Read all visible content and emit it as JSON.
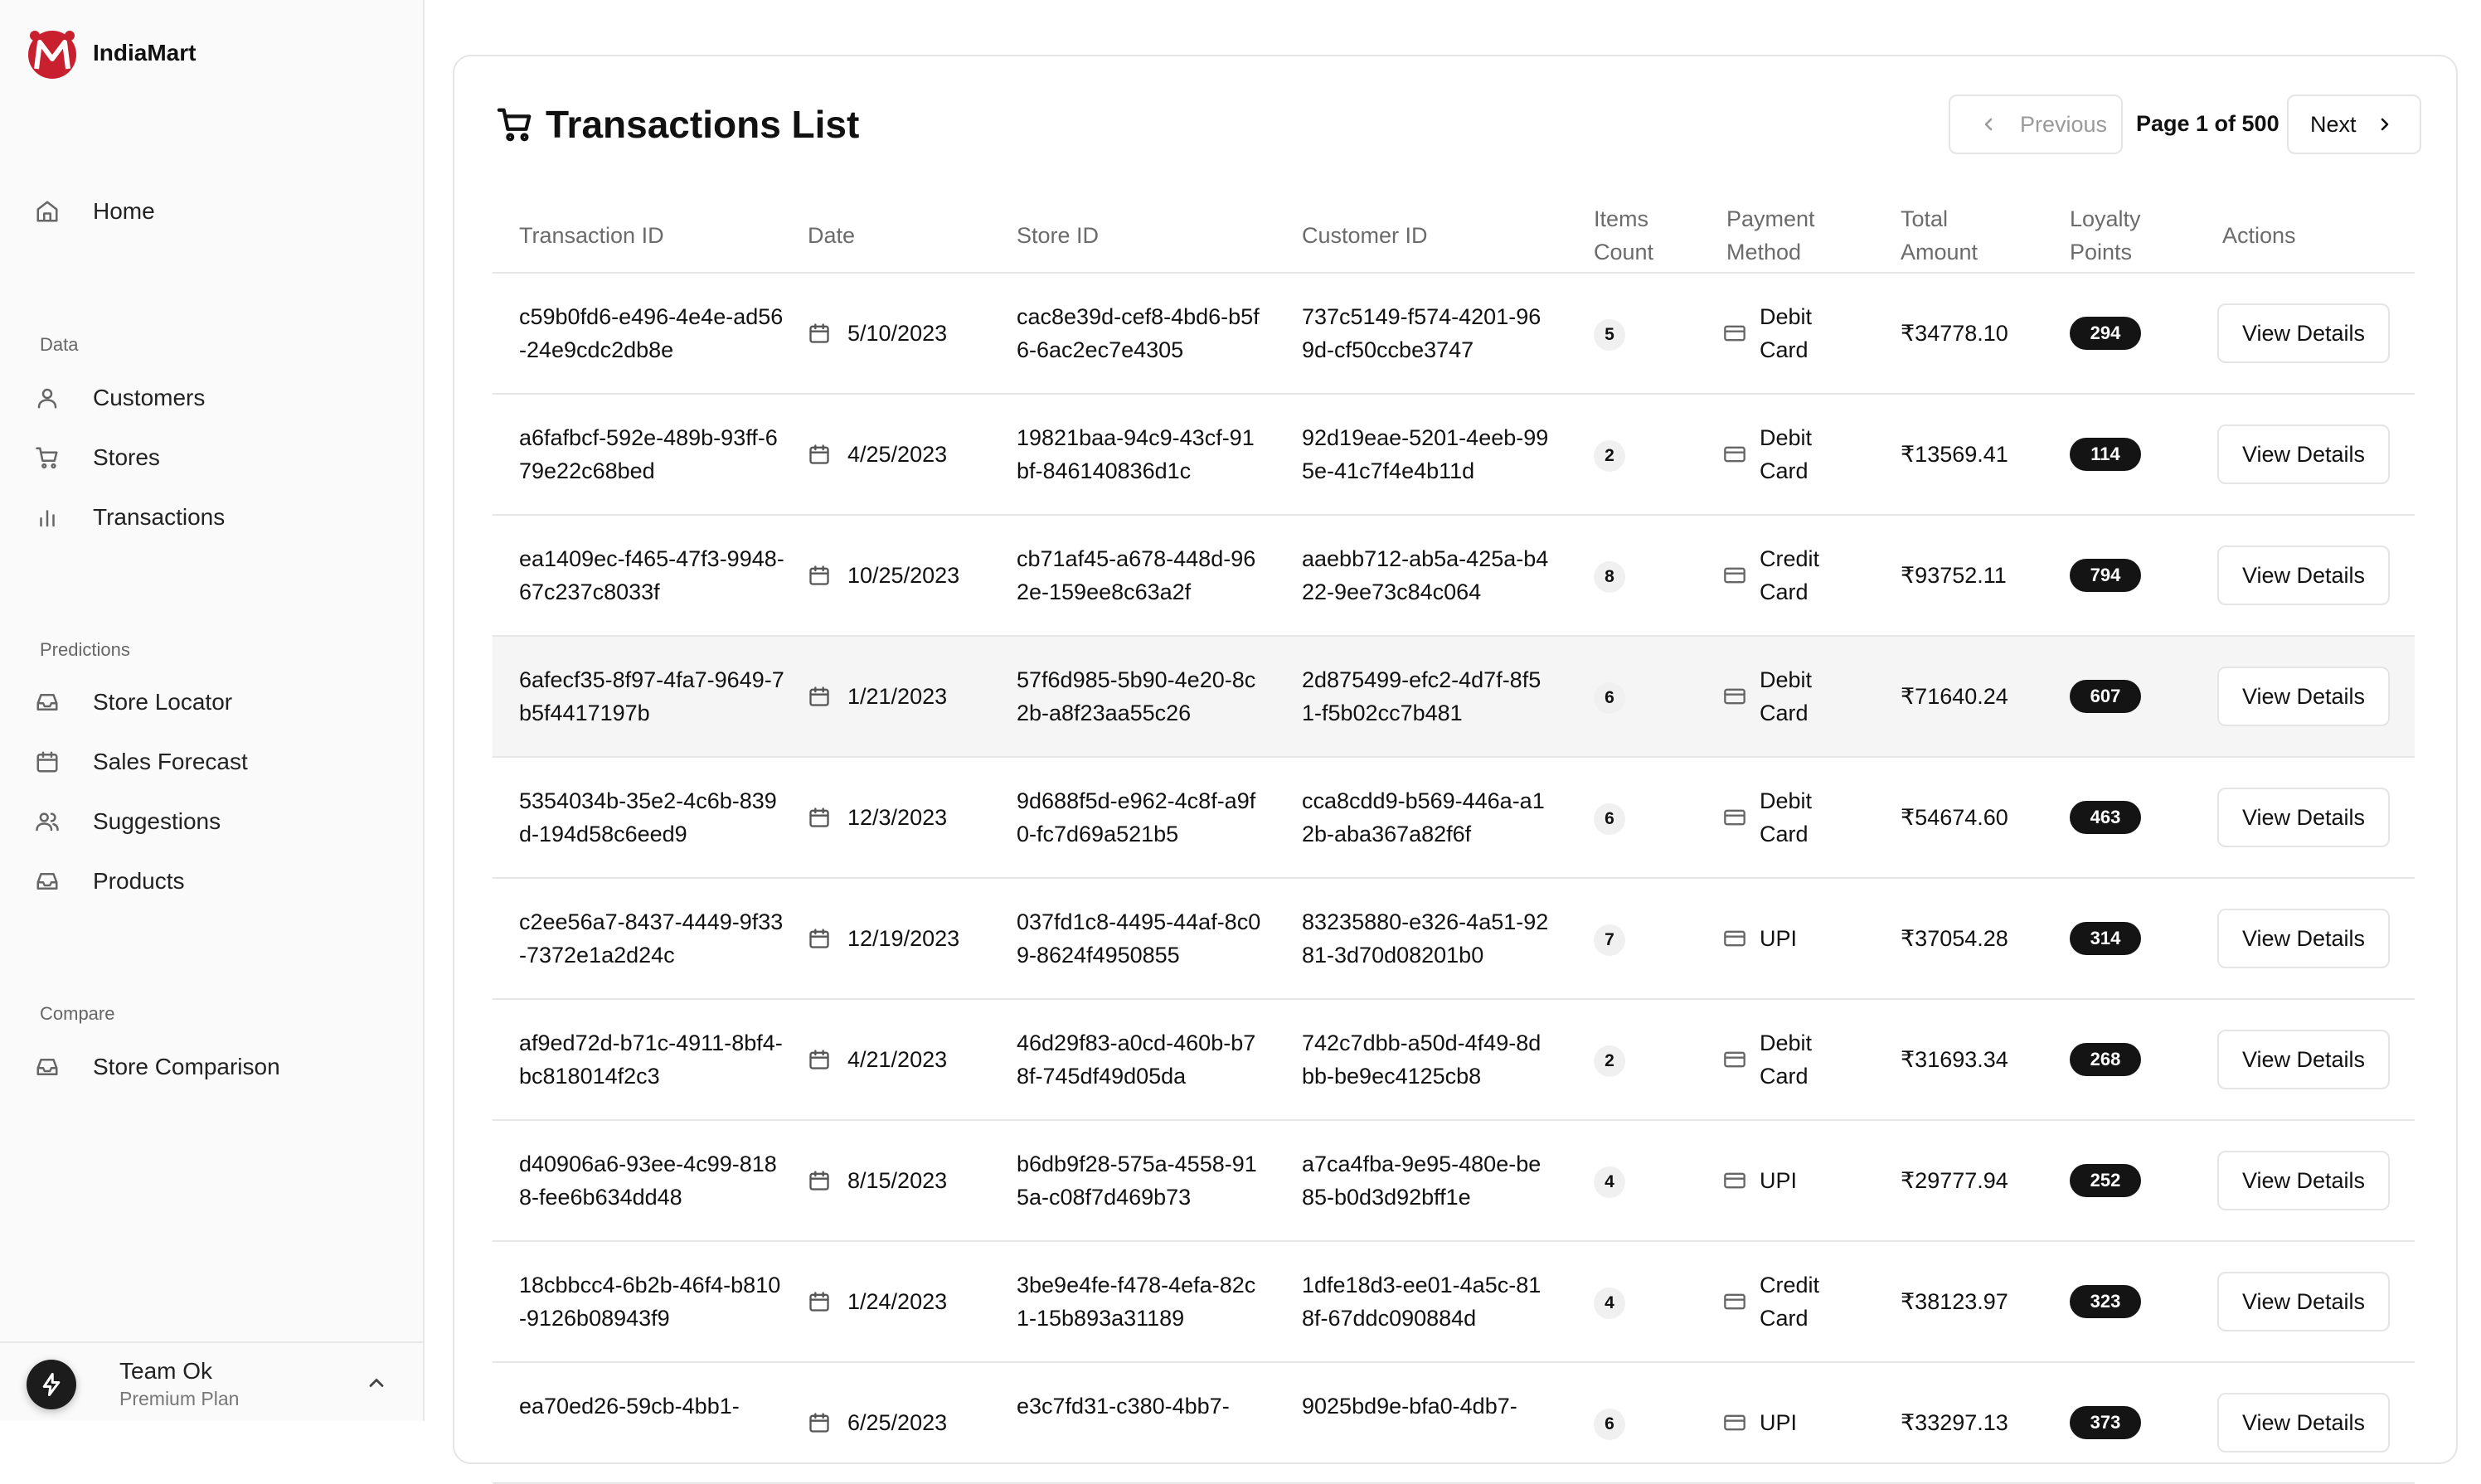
{
  "brand": {
    "name": "IndiaMart"
  },
  "sidebar": {
    "home": {
      "label": "Home",
      "icon": "home-icon"
    },
    "groups": {
      "data": "Data",
      "predictions": "Predictions",
      "compare": "Compare"
    },
    "data_items": [
      {
        "label": "Customers",
        "icon": "user-icon"
      },
      {
        "label": "Stores",
        "icon": "cart-icon"
      },
      {
        "label": "Transactions",
        "icon": "bar-chart-icon"
      }
    ],
    "prediction_items": [
      {
        "label": "Store Locator",
        "icon": "inbox-icon"
      },
      {
        "label": "Sales Forecast",
        "icon": "calendar-icon"
      },
      {
        "label": "Suggestions",
        "icon": "users-icon"
      },
      {
        "label": "Products",
        "icon": "inbox-icon"
      }
    ],
    "compare_items": [
      {
        "label": "Store Comparison",
        "icon": "inbox-icon"
      }
    ],
    "team": {
      "name": "Team Ok",
      "plan": "Premium Plan"
    }
  },
  "header": {
    "title": "Transactions List",
    "prev_label": "Previous",
    "page_indicator": "Page 1 of 500",
    "next_label": "Next"
  },
  "table": {
    "columns": [
      "Transaction ID",
      "Date",
      "Store ID",
      "Customer ID",
      "Items Count",
      "Payment Method",
      "Total Amount",
      "Loyalty Points",
      "Actions"
    ],
    "action_label": "View Details",
    "rows": [
      {
        "tid": "c59b0fd6-e496-4e4e-ad56-24e9cdc2db8e",
        "date": "5/10/2023",
        "sid": "cac8e39d-cef8-4bd6-b5f6-6ac2ec7e4305",
        "cid": "737c5149-f574-4201-969d-cf50ccbe3747",
        "items": "5",
        "pay": "Debit Card",
        "amount": "₹34778.10",
        "points": "294"
      },
      {
        "tid": "a6fafbcf-592e-489b-93ff-679e22c68bed",
        "date": "4/25/2023",
        "sid": "19821baa-94c9-43cf-91bf-846140836d1c",
        "cid": "92d19eae-5201-4eeb-995e-41c7f4e4b11d",
        "items": "2",
        "pay": "Debit Card",
        "amount": "₹13569.41",
        "points": "114"
      },
      {
        "tid": "ea1409ec-f465-47f3-9948-67c237c8033f",
        "date": "10/25/2023",
        "sid": "cb71af45-a678-448d-962e-159ee8c63a2f",
        "cid": "aaebb712-ab5a-425a-b422-9ee73c84c064",
        "items": "8",
        "pay": "Credit Card",
        "amount": "₹93752.11",
        "points": "794"
      },
      {
        "tid": "6afecf35-8f97-4fa7-9649-7b5f4417197b",
        "date": "1/21/2023",
        "sid": "57f6d985-5b90-4e20-8c2b-a8f23aa55c26",
        "cid": "2d875499-efc2-4d7f-8f51-f5b02cc7b481",
        "items": "6",
        "pay": "Debit Card",
        "amount": "₹71640.24",
        "points": "607"
      },
      {
        "tid": "5354034b-35e2-4c6b-839d-194d58c6eed9",
        "date": "12/3/2023",
        "sid": "9d688f5d-e962-4c8f-a9f0-fc7d69a521b5",
        "cid": "cca8cdd9-b569-446a-a12b-aba367a82f6f",
        "items": "6",
        "pay": "Debit Card",
        "amount": "₹54674.60",
        "points": "463"
      },
      {
        "tid": "c2ee56a7-8437-4449-9f33-7372e1a2d24c",
        "date": "12/19/2023",
        "sid": "037fd1c8-4495-44af-8c09-8624f4950855",
        "cid": "83235880-e326-4a51-9281-3d70d08201b0",
        "items": "7",
        "pay": "UPI",
        "amount": "₹37054.28",
        "points": "314"
      },
      {
        "tid": "af9ed72d-b71c-4911-8bf4-bc818014f2c3",
        "date": "4/21/2023",
        "sid": "46d29f83-a0cd-460b-b78f-745df49d05da",
        "cid": "742c7dbb-a50d-4f49-8dbb-be9ec4125cb8",
        "items": "2",
        "pay": "Debit Card",
        "amount": "₹31693.34",
        "points": "268"
      },
      {
        "tid": "d40906a6-93ee-4c99-8188-fee6b634dd48",
        "date": "8/15/2023",
        "sid": "b6db9f28-575a-4558-915a-c08f7d469b73",
        "cid": "a7ca4fba-9e95-480e-be85-b0d3d92bff1e",
        "items": "4",
        "pay": "UPI",
        "amount": "₹29777.94",
        "points": "252"
      },
      {
        "tid": "18cbbcc4-6b2b-46f4-b810-9126b08943f9",
        "date": "1/24/2023",
        "sid": "3be9e4fe-f478-4efa-82c1-15b893a31189",
        "cid": "1dfe18d3-ee01-4a5c-818f-67ddc090884d",
        "items": "4",
        "pay": "Credit Card",
        "amount": "₹38123.97",
        "points": "323"
      },
      {
        "tid": "ea70ed26-59cb-4bb1-",
        "date": "6/25/2023",
        "sid": "e3c7fd31-c380-4bb7-",
        "cid": "9025bd9e-bfa0-4db7-",
        "items": "6",
        "pay": "UPI",
        "amount": "₹33297.13",
        "points": "373"
      }
    ],
    "highlighted_row": 3
  }
}
